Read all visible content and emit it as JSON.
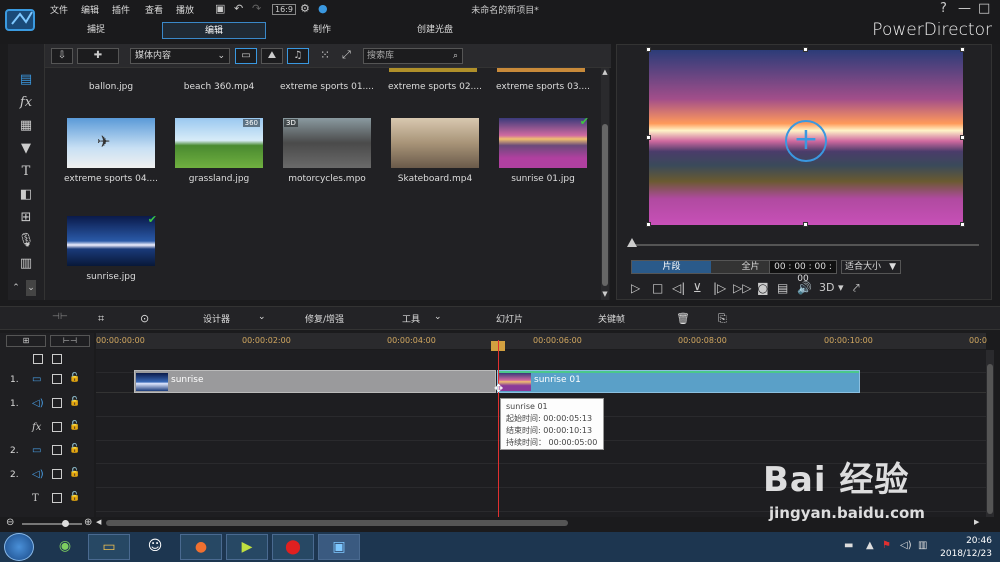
{
  "menu": [
    "文件",
    "编辑",
    "插件",
    "查看",
    "播放"
  ],
  "doc_title": "未命名的新项目*",
  "tabs": [
    "捕捉",
    "编辑",
    "制作",
    "创建光盘"
  ],
  "brand": "PowerDirector",
  "library": {
    "dropdown": "媒体内容",
    "search_placeholder": "搜索库",
    "top_captions": [
      "ballon.jpg",
      "beach 360.mp4",
      "extreme sports 01....",
      "extreme sports 02....",
      "extreme sports 03...."
    ],
    "items": [
      {
        "caption": "extreme sports 04....",
        "badge": ""
      },
      {
        "caption": "grassland.jpg",
        "badge": "360"
      },
      {
        "caption": "motorcycles.mpo",
        "badge": "3D"
      },
      {
        "caption": "Skateboard.mp4",
        "badge": ""
      },
      {
        "caption": "sunrise 01.jpg",
        "badge": "✔"
      },
      {
        "caption": "sunrise.jpg",
        "badge": "✔"
      }
    ]
  },
  "preview": {
    "tab_clip": "片段",
    "tab_movie": "全片",
    "timecode": "00 : 00 : 00 : 00",
    "fit": "适合大小",
    "mode_3d": "3D"
  },
  "timeline_toolbar": {
    "designer": "设计器",
    "fix": "修复/增强",
    "tools": "工具",
    "slideshow": "幻灯片",
    "keyframe": "关键帧"
  },
  "ruler": [
    "00:00:00:00",
    "00:00:02:00",
    "00:00:04:00",
    "00:00:06:00",
    "00:00:08:00",
    "00:00:10:00",
    "00:0"
  ],
  "tracks": [
    "1.",
    "1.",
    "",
    "2.",
    "2.",
    ""
  ],
  "clips": [
    {
      "label": "sunrise"
    },
    {
      "label": "sunrise 01"
    }
  ],
  "tooltip": {
    "title": "sunrise 01",
    "start": "起始时间: 00:00:05:13",
    "end": "结束时间: 00:00:10:13",
    "duration": "持续时间： 00:00:05:00"
  },
  "clock": {
    "time": "20:46",
    "date": "2018/12/23"
  },
  "watermark": {
    "brand": "Bai 经验",
    "url": "jingyan.baidu.com"
  }
}
